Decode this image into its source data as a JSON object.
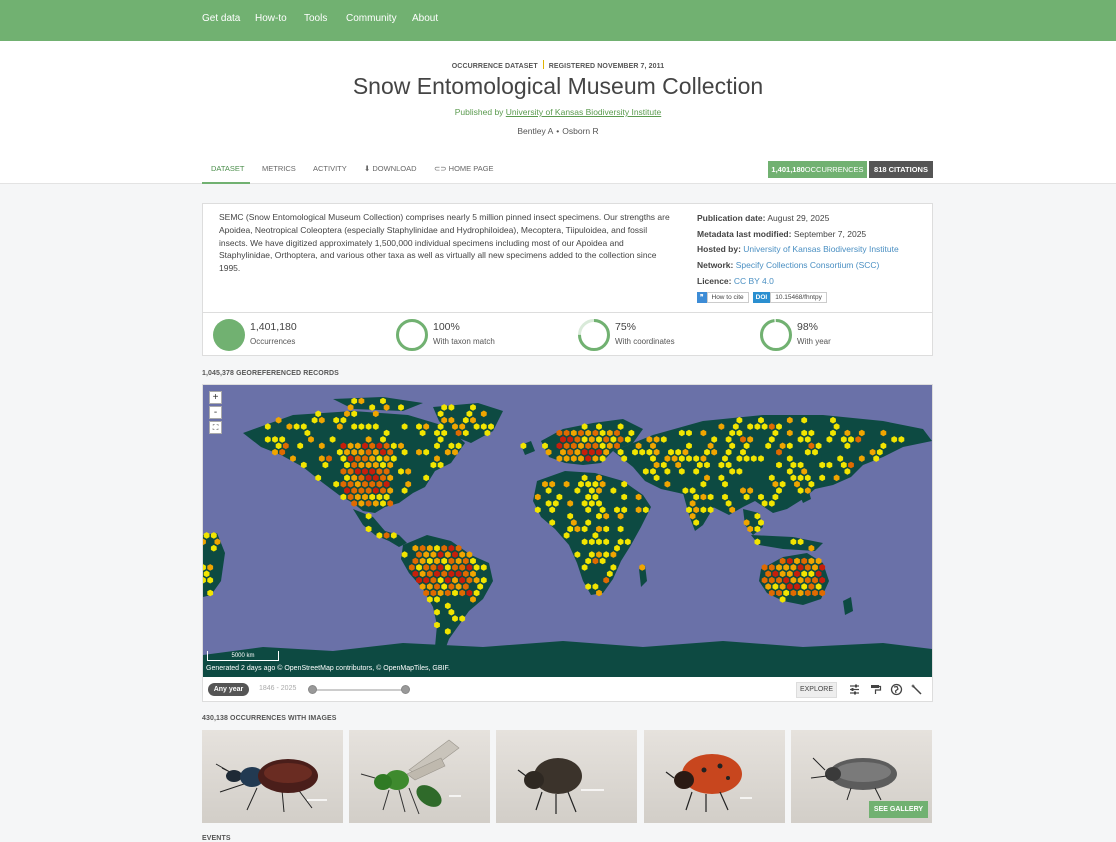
{
  "nav": {
    "items": [
      "Get data",
      "How-to",
      "Tools",
      "Community",
      "About"
    ]
  },
  "header": {
    "kicker_type": "OCCURRENCE DATASET",
    "kicker_registered": "REGISTERED NOVEMBER 7, 2011",
    "title": "Snow Entomological Museum Collection",
    "published_by": "Published by",
    "publisher": "University of Kansas Biodiversity Institute",
    "authors": [
      "Bentley A",
      "Osborn R"
    ]
  },
  "tabs": [
    "DATASET",
    "METRICS",
    "ACTIVITY",
    "DOWNLOAD",
    "HOME PAGE"
  ],
  "badges": {
    "occ_count": "1,401,180",
    "occ_label": "OCCURRENCES",
    "citations": "818 CITATIONS"
  },
  "description": "SEMC (Snow Entomological Museum Collection) comprises nearly 5 million pinned insect specimens. Our strengths are Apoidea, Neotropical Coleoptera (especially Staphylinidae and Hydrophiloidea), Mecoptera, Tiipuloidea, and fossil insects. We have digitized approximately 1,500,000 individual specimens including most of our Apoidea and Staphylinidae, Orthoptera, and various other taxa as well as virtually all new specimens added to the collection since 1995.",
  "meta": {
    "pubdate_label": "Publication date:",
    "pubdate": "August 29, 2025",
    "modified_label": "Metadata last modified:",
    "modified": "September 7, 2025",
    "hosted_label": "Hosted by:",
    "hosted": "University of Kansas Biodiversity Institute",
    "network_label": "Network:",
    "network": "Specify Collections Consortium (SCC)",
    "licence_label": "Licence:",
    "licence": "CC BY 4.0",
    "howtocite": "How to cite",
    "doi_label": "DOI",
    "doi": "10.15468/fhntpy"
  },
  "stats": [
    {
      "value": "1,401,180",
      "label": "Occurrences",
      "fraction": 1.0
    },
    {
      "value": "100%",
      "label": "With taxon match",
      "fraction": 1.0
    },
    {
      "value": "75%",
      "label": "With coordinates",
      "fraction": 0.75
    },
    {
      "value": "98%",
      "label": "With year",
      "fraction": 0.98
    }
  ],
  "map": {
    "section_label": "1,045,378 GEOREFERENCED RECORDS",
    "zoom_in": "+",
    "zoom_out": "-",
    "fullscreen": "⛶",
    "scale": "5000 km",
    "attribution": "Generated 2 days ago © OpenStreetMap contributors, © OpenMapTiles, GBIF.",
    "any_year": "Any year",
    "year_range": "1846 - 2025",
    "explore": "EXPLORE",
    "colors": {
      "ocean": "#6a71a8",
      "land": "#0d4a42",
      "low": "#f2e500",
      "mid": "#f0a500",
      "high": "#e06a00",
      "max": "#c81e0a"
    }
  },
  "gallery": {
    "section_label": "430,138 OCCURRENCES WITH IMAGES",
    "see_gallery": "SEE GALLERY"
  },
  "events_label": "EVENTS"
}
